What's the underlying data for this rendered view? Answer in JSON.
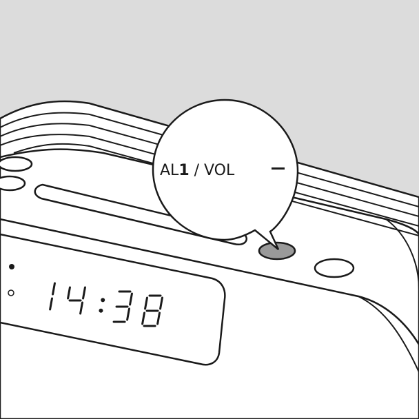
{
  "callout": {
    "prefix": "AL",
    "number": "1",
    "suffix": " / VOL"
  },
  "display": {
    "time": "14:38"
  },
  "colors": {
    "background": "#dcdcdc",
    "outline": "#1a1a1a",
    "device": "#ffffff",
    "highlighted_button": "#9a9a9a"
  },
  "icons": {
    "vol_down": "minus-icon"
  }
}
